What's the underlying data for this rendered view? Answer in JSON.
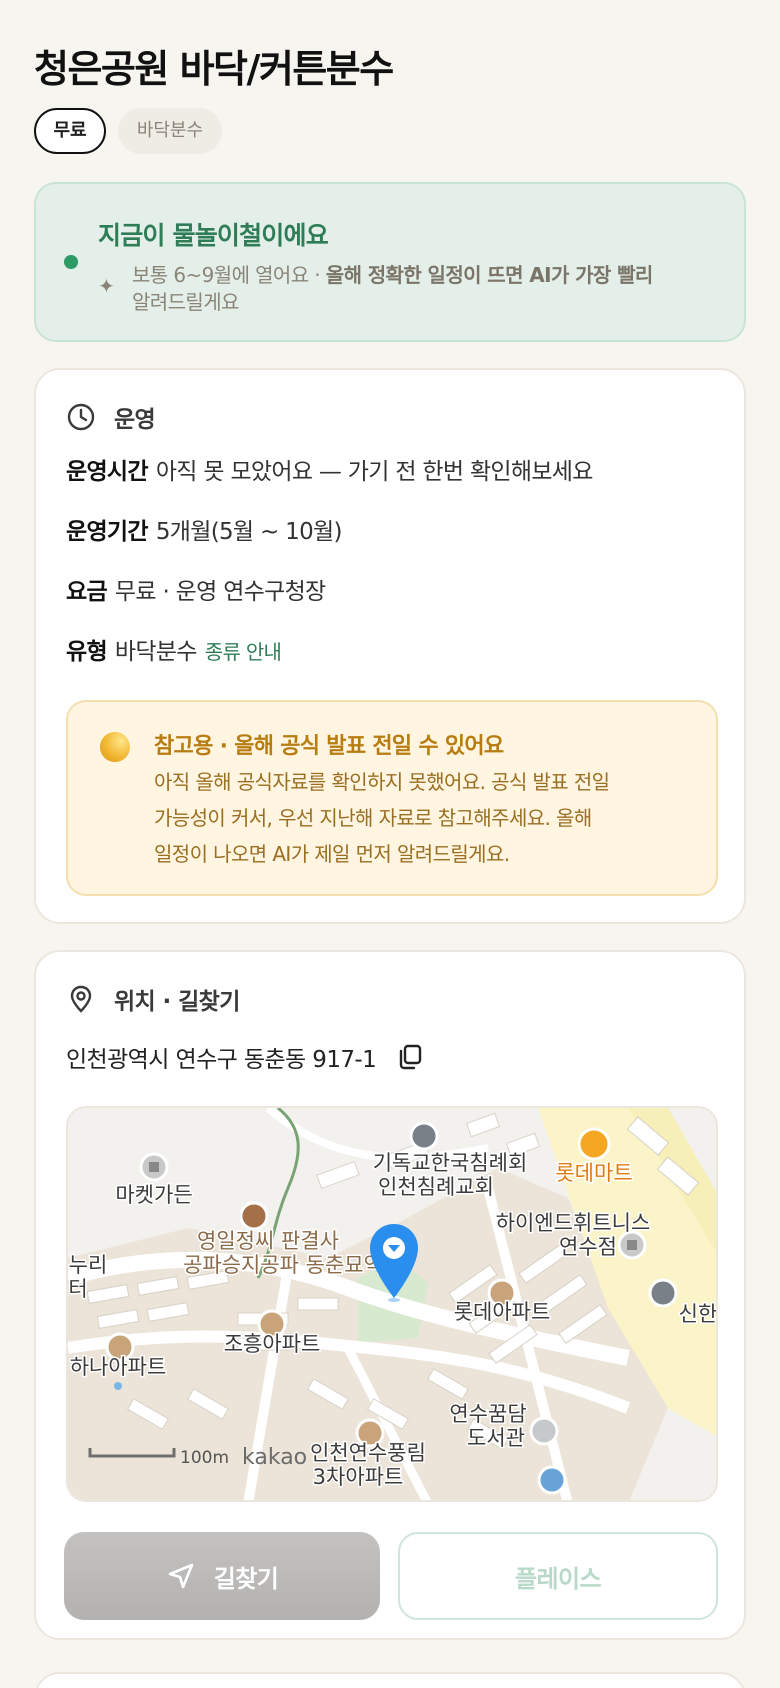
{
  "title": "청은공원 바닥/커튼분수",
  "chips": {
    "free": "무료",
    "type": "바닥분수"
  },
  "season": {
    "heading": "지금이 물놀이철이에요",
    "desc_prefix": "보통 6~9월에 열어요 · ",
    "desc_bold": "올해 정확한 일정이 뜨면 AI가 가장 빨리",
    "desc_suffix": "알려드릴게요",
    "accent": "#2e9a64"
  },
  "operation": {
    "header": "운영",
    "hours_key": "운영시간",
    "hours_value": "아직 못 모았어요 — 가기 전 한번 확인해보세요",
    "period_key": "운영기간",
    "period_value": "5개월(5월 ~ 10월)",
    "fee_key": "요금",
    "fee_value": "무료 · 운영 연수구청장",
    "type_key": "유형",
    "type_value": "바닥분수",
    "type_link": "종류 안내",
    "notice_title": "참고용 · 올해 공식 발표 전일 수 있어요",
    "notice_line1": "아직 올해 공식자료를 확인하지 못했어요. 공식 발표 전일",
    "notice_line2": "가능성이 커서, 우선 지난해 자료로 참고해주세요. 올해",
    "notice_line3": "일정이 나오면 AI가 제일 먼저 알려드릴게요."
  },
  "location": {
    "header": "위치 · 길찾기",
    "address": "인천광역시 연수구 동춘동 917-1",
    "copy_icon": "copy-icon",
    "map": {
      "labels": {
        "market_garden": "마켓가든",
        "church1": "기독교한국침례회",
        "church2": "인천침례교회",
        "lotte": "롯데마트",
        "tomb1": "영일정씨 판결사",
        "tomb2": "공파승지공파 동춘묘역",
        "hiend1": "하이엔드휘트니스",
        "hiend2": "연수점",
        "nuri1": "누리",
        "nuri2": "터",
        "lotte_apt": "롯데아파트",
        "shinhan": "신한",
        "joheung": "조흥아파트",
        "hana": "하나아파트",
        "dream1": "연수꿈담",
        "dream2": "도서관",
        "pungrim1": "인천연수풍림",
        "pungrim2": "3차아파트",
        "scale": "100m",
        "brand": "kakao"
      }
    },
    "directions_label": "길찾기",
    "place_label": "플레이스"
  }
}
